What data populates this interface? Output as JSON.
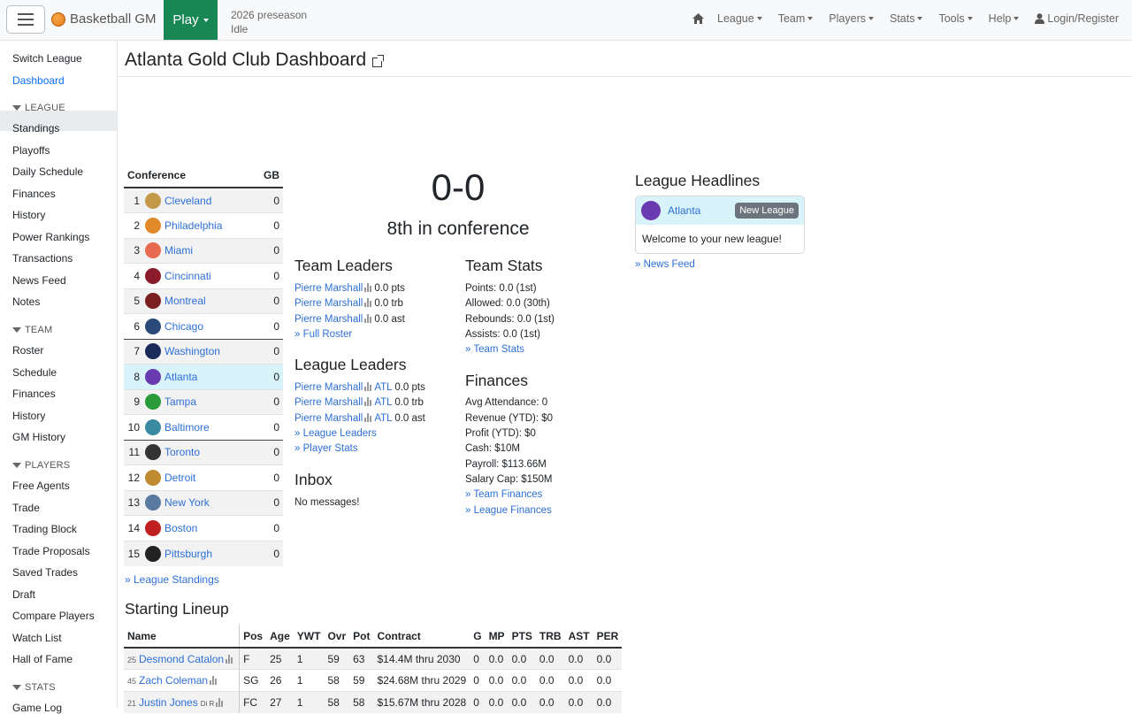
{
  "navbar": {
    "brand": "Basketball GM",
    "play_label": "Play",
    "status_season": "2026 preseason",
    "status_state": "Idle",
    "menus": [
      "League",
      "Team",
      "Players",
      "Stats",
      "Tools",
      "Help"
    ],
    "login_label": "Login/Register"
  },
  "sidebar": {
    "top": [
      "Switch League",
      "Dashboard"
    ],
    "league_header": "LEAGUE",
    "league": [
      "Standings",
      "Playoffs",
      "Daily Schedule",
      "Finances",
      "History",
      "Power Rankings",
      "Transactions",
      "News Feed",
      "Notes"
    ],
    "team_header": "TEAM",
    "team": [
      "Roster",
      "Schedule",
      "Finances",
      "History",
      "GM History"
    ],
    "players_header": "PLAYERS",
    "players": [
      "Free Agents",
      "Trade",
      "Trading Block",
      "Trade Proposals",
      "Saved Trades",
      "Draft",
      "Compare Players",
      "Watch List",
      "Hall of Fame"
    ],
    "stats_header": "STATS",
    "stats": [
      "Game Log"
    ]
  },
  "page": {
    "title": "Atlanta Gold Club Dashboard"
  },
  "standings": {
    "header_conf": "Conference",
    "header_gb": "GB",
    "rows": [
      {
        "rank": "1",
        "team": "Cleveland",
        "gb": "0",
        "color": "#c49a4a"
      },
      {
        "rank": "2",
        "team": "Philadelphia",
        "gb": "0",
        "color": "#e08a2a"
      },
      {
        "rank": "3",
        "team": "Miami",
        "gb": "0",
        "color": "#e86a50"
      },
      {
        "rank": "4",
        "team": "Cincinnati",
        "gb": "0",
        "color": "#8b1a2a"
      },
      {
        "rank": "5",
        "team": "Montreal",
        "gb": "0",
        "color": "#7a2020"
      },
      {
        "rank": "6",
        "team": "Chicago",
        "gb": "0",
        "color": "#2a4a7a"
      },
      {
        "rank": "7",
        "team": "Washington",
        "gb": "0",
        "color": "#1a2a5a"
      },
      {
        "rank": "8",
        "team": "Atlanta",
        "gb": "0",
        "color": "#6a3ab0"
      },
      {
        "rank": "9",
        "team": "Tampa",
        "gb": "0",
        "color": "#2a9a3a"
      },
      {
        "rank": "10",
        "team": "Baltimore",
        "gb": "0",
        "color": "#3a8aa0"
      },
      {
        "rank": "11",
        "team": "Toronto",
        "gb": "0",
        "color": "#333333"
      },
      {
        "rank": "12",
        "team": "Detroit",
        "gb": "0",
        "color": "#c08a30"
      },
      {
        "rank": "13",
        "team": "New York",
        "gb": "0",
        "color": "#5a7aa0"
      },
      {
        "rank": "14",
        "team": "Boston",
        "gb": "0",
        "color": "#c02020"
      },
      {
        "rank": "15",
        "team": "Pittsburgh",
        "gb": "0",
        "color": "#222222"
      }
    ],
    "link": "» League Standings"
  },
  "record": {
    "wl": "0-0",
    "conf_rank": "8th in conference"
  },
  "team_leaders": {
    "header": "Team Leaders",
    "rows": [
      {
        "name": "Pierre Marshall",
        "stat": "0.0 pts"
      },
      {
        "name": "Pierre Marshall",
        "stat": "0.0 trb"
      },
      {
        "name": "Pierre Marshall",
        "stat": "0.0 ast"
      }
    ],
    "link": "» Full Roster"
  },
  "league_leaders": {
    "header": "League Leaders",
    "rows": [
      {
        "name": "Pierre Marshall",
        "team": "ATL",
        "stat": "0.0 pts"
      },
      {
        "name": "Pierre Marshall",
        "team": "ATL",
        "stat": "0.0 trb"
      },
      {
        "name": "Pierre Marshall",
        "team": "ATL",
        "stat": "0.0 ast"
      }
    ],
    "link1": "» League Leaders",
    "link2": "» Player Stats"
  },
  "inbox": {
    "header": "Inbox",
    "text": "No messages!"
  },
  "team_stats": {
    "header": "Team Stats",
    "lines": [
      "Points: 0.0 (1st)",
      "Allowed: 0.0 (30th)",
      "Rebounds: 0.0 (1st)",
      "Assists: 0.0 (1st)"
    ],
    "link": "» Team Stats"
  },
  "finances": {
    "header": "Finances",
    "lines": [
      "Avg Attendance: 0",
      "Revenue (YTD): $0",
      "Profit (YTD): $0",
      "Cash: $10M",
      "Payroll: $113.66M",
      "Salary Cap: $150M"
    ],
    "link1": "» Team Finances",
    "link2": "» League Finances"
  },
  "headlines": {
    "header": "League Headlines",
    "team": "Atlanta",
    "badge": "New League",
    "text": "Welcome to your new league!",
    "link": "» News Feed"
  },
  "lineup": {
    "header": "Starting Lineup",
    "columns": [
      "Name",
      "Pos",
      "Age",
      "YWT",
      "Ovr",
      "Pot",
      "Contract",
      "G",
      "MP",
      "PTS",
      "TRB",
      "AST",
      "PER"
    ],
    "rows": [
      {
        "num": "25",
        "name": "Desmond Catalon",
        "skills": "",
        "pos": "F",
        "age": "25",
        "ywt": "1",
        "ovr": "59",
        "pot": "63",
        "contract": "$14.4M thru 2030",
        "g": "0",
        "mp": "0.0",
        "pts": "0.0",
        "trb": "0.0",
        "ast": "0.0",
        "per": "0.0"
      },
      {
        "num": "45",
        "name": "Zach Coleman",
        "skills": "",
        "pos": "SG",
        "age": "26",
        "ywt": "1",
        "ovr": "58",
        "pot": "59",
        "contract": "$24.68M thru 2029",
        "g": "0",
        "mp": "0.0",
        "pts": "0.0",
        "trb": "0.0",
        "ast": "0.0",
        "per": "0.0"
      },
      {
        "num": "21",
        "name": "Justin Jones",
        "skills": "Di R",
        "pos": "FC",
        "age": "27",
        "ywt": "1",
        "ovr": "58",
        "pot": "58",
        "contract": "$15.67M thru 2028",
        "g": "0",
        "mp": "0.0",
        "pts": "0.0",
        "trb": "0.0",
        "ast": "0.0",
        "per": "0.0"
      }
    ]
  }
}
